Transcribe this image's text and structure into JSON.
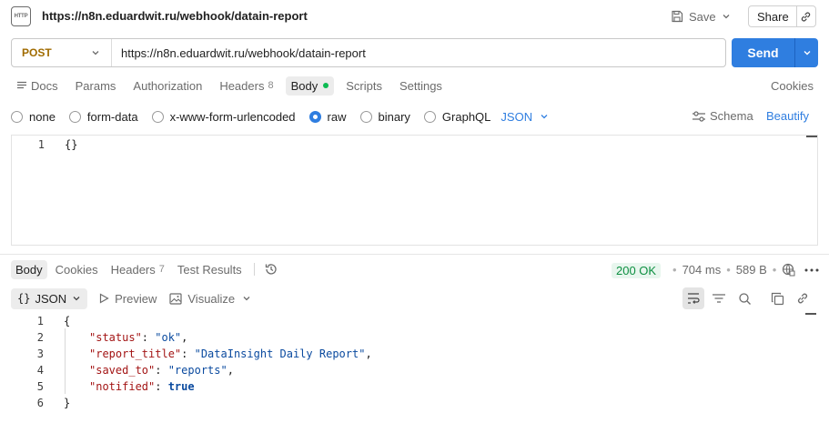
{
  "header": {
    "badge": "HTTP",
    "title": "https://n8n.eduardwit.ru/webhook/datain-report",
    "save_label": "Save",
    "share_label": "Share"
  },
  "request": {
    "method": "POST",
    "url": "https://n8n.eduardwit.ru/webhook/datain-report",
    "send_label": "Send"
  },
  "request_tabs": {
    "docs": "Docs",
    "params": "Params",
    "authorization": "Authorization",
    "headers": "Headers",
    "headers_count": "8",
    "body": "Body",
    "scripts": "Scripts",
    "settings": "Settings",
    "cookies": "Cookies"
  },
  "body_types": {
    "none": "none",
    "form_data": "form-data",
    "urlencoded": "x-www-form-urlencoded",
    "raw": "raw",
    "binary": "binary",
    "graphql": "GraphQL",
    "format": "JSON",
    "schema": "Schema",
    "beautify": "Beautify",
    "selected": "raw"
  },
  "request_body": {
    "lines": [
      {
        "num": "1",
        "text": "{}"
      }
    ]
  },
  "response_tabs": {
    "body": "Body",
    "cookies": "Cookies",
    "headers": "Headers",
    "headers_count": "7",
    "test_results": "Test Results"
  },
  "response_status": {
    "status": "200 OK",
    "time": "704 ms",
    "size": "589 B"
  },
  "response_toolbar": {
    "format_label": "JSON",
    "preview": "Preview",
    "visualize": "Visualize"
  },
  "response_body": {
    "line_numbers": [
      "1",
      "2",
      "3",
      "4",
      "5",
      "6"
    ],
    "open_brace": "{",
    "close_brace": "}",
    "fields": [
      {
        "key": "\"status\"",
        "value": "\"ok\"",
        "comma": ","
      },
      {
        "key": "\"report_title\"",
        "value": "\"DataInsight Daily Report\"",
        "comma": ","
      },
      {
        "key": "\"saved_to\"",
        "value": "\"reports\"",
        "comma": ","
      },
      {
        "key": "\"notified\"",
        "value": "true",
        "comma": ""
      }
    ]
  },
  "colors": {
    "accent": "#2f7ee0",
    "method": "#a06b00",
    "success": "#0d8f41",
    "json_key": "#a31515",
    "json_string": "#0a4a9f"
  }
}
